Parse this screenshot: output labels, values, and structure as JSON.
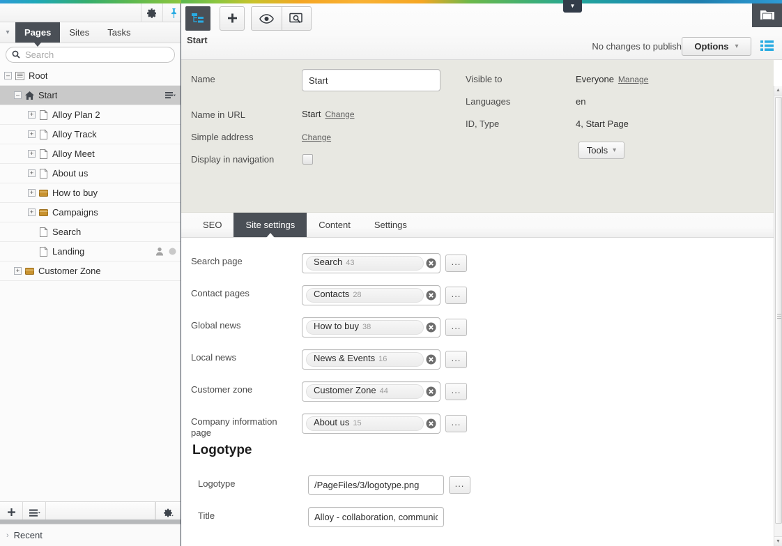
{
  "sidebar": {
    "tabs": [
      {
        "label": "Pages",
        "active": true
      },
      {
        "label": "Sites",
        "active": false
      },
      {
        "label": "Tasks",
        "active": false
      }
    ],
    "search": {
      "value": "",
      "placeholder": "Search"
    },
    "tree": [
      {
        "label": "Root",
        "indent": 0,
        "expander": "minus",
        "icon": "root-icon",
        "selected": false,
        "menu": false,
        "badges": []
      },
      {
        "label": "Start",
        "indent": 14,
        "expander": "minus",
        "icon": "home-icon",
        "selected": true,
        "menu": true,
        "badges": []
      },
      {
        "label": "Alloy Plan 2",
        "indent": 34,
        "expander": "plus",
        "icon": "page-icon",
        "selected": false,
        "menu": false,
        "badges": []
      },
      {
        "label": "Alloy Track",
        "indent": 34,
        "expander": "plus",
        "icon": "page-icon",
        "selected": false,
        "menu": false,
        "badges": []
      },
      {
        "label": "Alloy Meet",
        "indent": 34,
        "expander": "plus",
        "icon": "page-icon",
        "selected": false,
        "menu": false,
        "badges": []
      },
      {
        "label": "About us",
        "indent": 34,
        "expander": "plus",
        "icon": "page-icon",
        "selected": false,
        "menu": false,
        "badges": []
      },
      {
        "label": "How to buy",
        "indent": 34,
        "expander": "plus",
        "icon": "folder-icon",
        "selected": false,
        "menu": false,
        "badges": []
      },
      {
        "label": "Campaigns",
        "indent": 34,
        "expander": "plus",
        "icon": "folder-icon",
        "selected": false,
        "menu": false,
        "badges": []
      },
      {
        "label": "Search",
        "indent": 34,
        "expander": "none",
        "icon": "page-icon",
        "selected": false,
        "menu": false,
        "badges": []
      },
      {
        "label": "Landing",
        "indent": 34,
        "expander": "none",
        "icon": "page-icon",
        "selected": false,
        "menu": false,
        "badges": [
          "user-icon",
          "dot-icon"
        ]
      },
      {
        "label": "Customer Zone",
        "indent": 14,
        "expander": "plus",
        "icon": "folder-icon",
        "selected": false,
        "menu": false,
        "badges": []
      }
    ],
    "footer": {
      "add_label": "+",
      "menu_icon": "hamburger-icon",
      "settings_icon": "gear-icon"
    },
    "recent": {
      "label": "Recent",
      "caret": "›"
    },
    "topbar": {
      "gear_icon": "gear-icon",
      "pin_icon": "pin-icon"
    }
  },
  "toolbar": {
    "tree_icon": "sitemap-icon",
    "add_icon": "plus-icon",
    "view_icon": "eye-icon",
    "preview_icon": "preview-icon",
    "page_name": "Start",
    "publish_status": "No changes to publish",
    "options_label": "Options",
    "options_caret": "⌄",
    "list_icon": "list-icon",
    "folder_icon": "folder-icon",
    "dropdown_tab_icon": "chevron-down-icon"
  },
  "properties": {
    "name_label": "Name",
    "name_value": "Start",
    "name_in_url_label": "Name in URL",
    "name_in_url_value": "Start",
    "name_in_url_change": "Change",
    "simple_address_label": "Simple address",
    "simple_address_change": "Change",
    "display_in_navigation_label": "Display in navigation",
    "visible_to_label": "Visible to",
    "visible_to_value": "Everyone",
    "visible_to_manage": "Manage",
    "languages_label": "Languages",
    "languages_value": "en",
    "id_type_label": "ID, Type",
    "id_type_value": "4, Start Page",
    "tools_label": "Tools",
    "tools_caret": "⌄"
  },
  "content_tabs": [
    {
      "label": "SEO",
      "active": false
    },
    {
      "label": "Site settings",
      "active": true
    },
    {
      "label": "Content",
      "active": false
    },
    {
      "label": "Settings",
      "active": false
    }
  ],
  "form": {
    "picker_rows": [
      {
        "label": "Search page",
        "chip": "Search",
        "num": "43",
        "dots": "..."
      },
      {
        "label": "Contact pages",
        "chip": "Contacts",
        "num": "28",
        "dots": "..."
      },
      {
        "label": "Global news",
        "chip": "How to buy",
        "num": "38",
        "dots": "..."
      },
      {
        "label": "Local news",
        "chip": "News & Events",
        "num": "16",
        "dots": "..."
      },
      {
        "label": "Customer zone",
        "chip": "Customer Zone",
        "num": "44",
        "dots": "..."
      },
      {
        "label": "Company information page",
        "chip": "About us",
        "num": "15",
        "dots": "..."
      }
    ],
    "section_heading": "Logotype",
    "logotype_label": "Logotype",
    "logotype_value": "/PageFiles/3/logotype.png",
    "logotype_dots": "...",
    "title_label": "Title",
    "title_value": "Alloy - collaboration, communication, community"
  },
  "colors": {
    "accent_blue": "#29abe2",
    "dark_chrome": "#4a4f56",
    "panel_beige": "#e8e8e2"
  }
}
